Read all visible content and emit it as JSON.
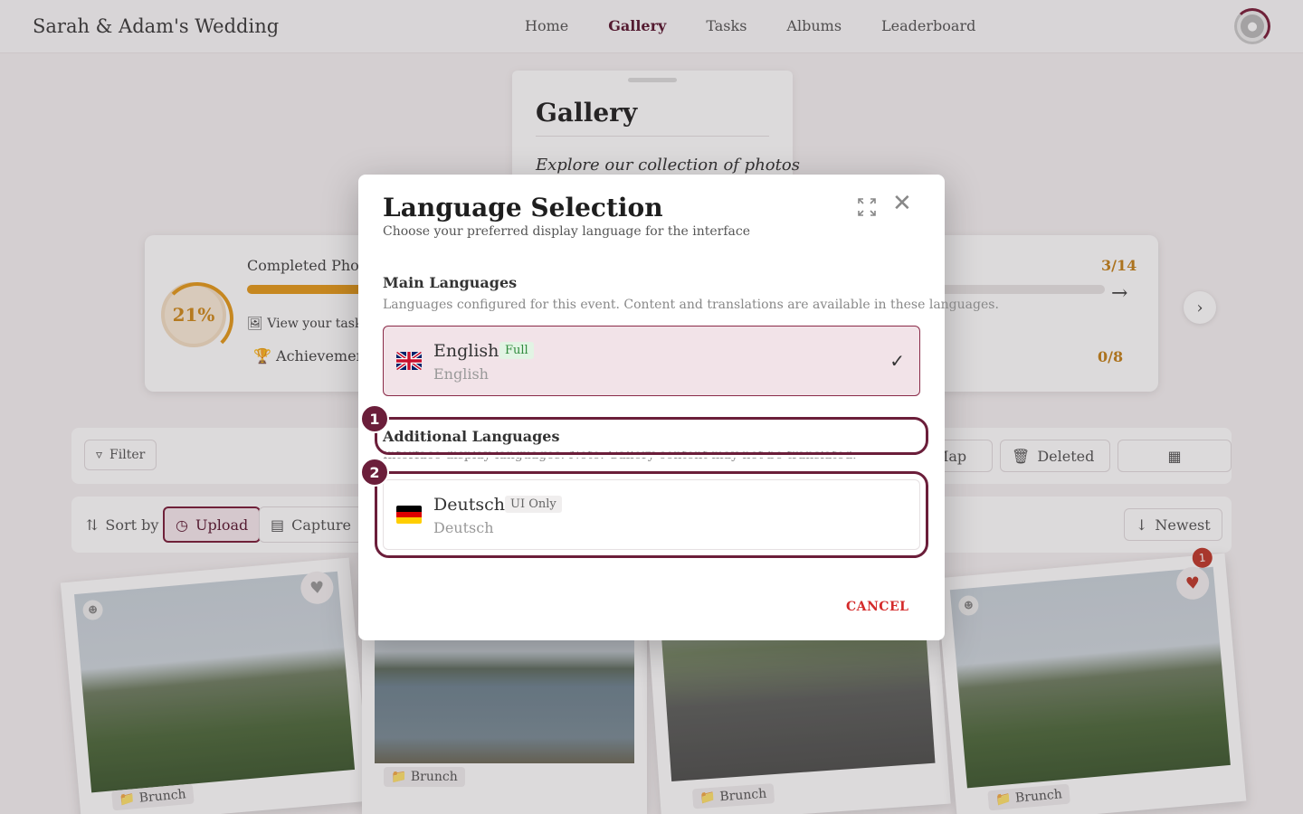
{
  "app": {
    "brand": "Sarah & Adam's Wedding"
  },
  "nav": {
    "items": [
      "Home",
      "Gallery",
      "Tasks",
      "Albums",
      "Leaderboard"
    ],
    "active": "Gallery"
  },
  "gallery_header": {
    "title": "Gallery",
    "subtitle": "Explore our collection of photos"
  },
  "progress": {
    "percent_label": "21%",
    "percent_value": 21,
    "completed_label": "Completed Photo",
    "task_link": "View your task p",
    "achievements": "Achievemen",
    "count_top": "3/14",
    "count_bottom": "0/8"
  },
  "filters": {
    "filter": "Filter",
    "map": "Map",
    "deleted": "Deleted"
  },
  "sort": {
    "sort_by": "Sort by",
    "upload": "Upload",
    "capture": "Capture",
    "newest": "Newest"
  },
  "photos": [
    {
      "tag": "Brunch"
    },
    {
      "tag": "Brunch"
    },
    {
      "tag": "Brunch"
    },
    {
      "tag": "Brunch",
      "likes": "1"
    }
  ],
  "modal": {
    "title": "Language Selection",
    "subtitle": "Choose your preferred display language for the interface",
    "main_heading": "Main Languages",
    "main_desc": "Languages configured for this event. Content and translations are available in these languages.",
    "additional_heading": "Additional Languages",
    "additional_desc": "Interface display languages. Note: Gallery content may not be translated.",
    "languages": [
      {
        "name": "English",
        "native": "English",
        "badge": "Full",
        "selected": true
      },
      {
        "name": "Deutsch",
        "native": "Deutsch",
        "badge": "UI Only",
        "selected": false
      }
    ],
    "cancel": "CANCEL"
  },
  "annotations": [
    "1",
    "2"
  ],
  "colors": {
    "accent": "#6b1e3a",
    "progress": "#e59a1c",
    "cancel": "#d42a2a"
  }
}
